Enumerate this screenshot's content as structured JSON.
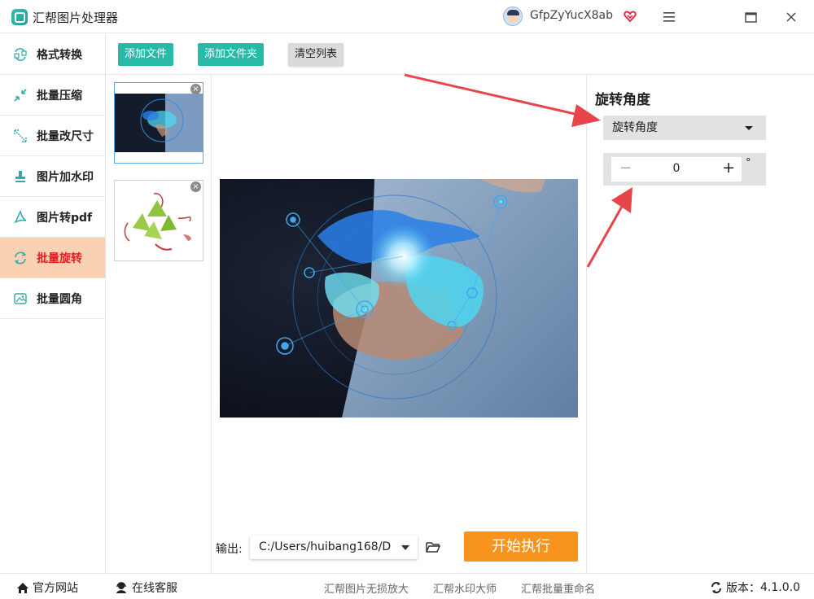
{
  "app": {
    "title": "汇帮图片处理器",
    "username": "GfpZyYucX8ab"
  },
  "window_controls": {
    "menu_icon": "hamburger-icon",
    "maximize_icon": "maximize-icon",
    "close_icon": "close-icon"
  },
  "sidebar": {
    "items": [
      {
        "label": "格式转换",
        "icon": "format-convert-icon"
      },
      {
        "label": "批量压缩",
        "icon": "compress-icon"
      },
      {
        "label": "批量改尺寸",
        "icon": "resize-icon"
      },
      {
        "label": "图片加水印",
        "icon": "watermark-icon"
      },
      {
        "label": "图片转pdf",
        "icon": "pdf-icon"
      },
      {
        "label": "批量旋转",
        "icon": "rotate-icon",
        "active": true
      },
      {
        "label": "批量圆角",
        "icon": "round-corner-icon"
      }
    ]
  },
  "toolbar": {
    "add_file": "添加文件",
    "add_folder": "添加文件夹",
    "clear_list": "清空列表"
  },
  "output": {
    "label": "输出:",
    "path": "C:/Users/huibang168/D"
  },
  "start_button": "开始执行",
  "right_panel": {
    "title": "旋转角度",
    "select_value": "旋转角度",
    "angle_value": "0",
    "unit": "°"
  },
  "bottom": {
    "website": "官方网站",
    "support": "在线客服",
    "links": [
      "汇帮图片无损放大",
      "汇帮水印大师",
      "汇帮批量重命名"
    ],
    "version_label": "版本：",
    "version": "4.1.0.0"
  },
  "colors": {
    "accent_teal": "#28b9a7",
    "active_bg": "#fbd1b4",
    "active_text": "#e02020",
    "start_orange": "#f7941d",
    "annotation_red": "#e8454a"
  }
}
